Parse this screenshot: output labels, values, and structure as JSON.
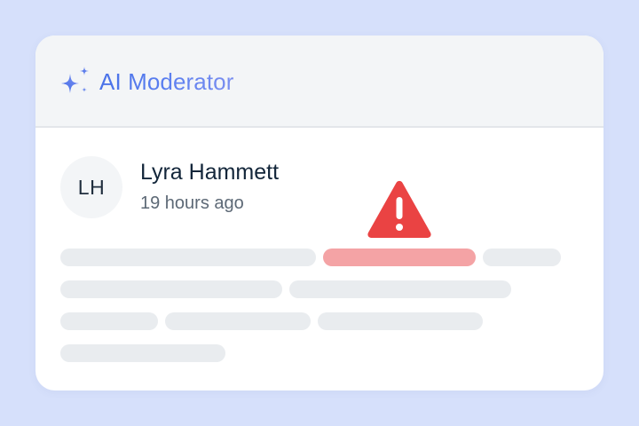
{
  "header": {
    "title": "AI Moderator",
    "icon": "sparkles-icon",
    "accent_color": "#4a72e8"
  },
  "post": {
    "author": {
      "initials": "LH",
      "name": "Lyra Hammett"
    },
    "timestamp": "19 hours ago",
    "flag": {
      "icon": "warning-icon",
      "color": "#ea4343",
      "highlight_color": "#f4a3a5"
    },
    "content_lines": [
      {
        "flagged": false
      },
      {
        "flagged": true
      },
      {
        "flagged": false
      },
      {
        "flagged": false
      },
      {
        "flagged": false
      },
      {
        "flagged": false
      },
      {
        "flagged": false
      },
      {
        "flagged": false
      },
      {
        "flagged": false
      }
    ]
  }
}
